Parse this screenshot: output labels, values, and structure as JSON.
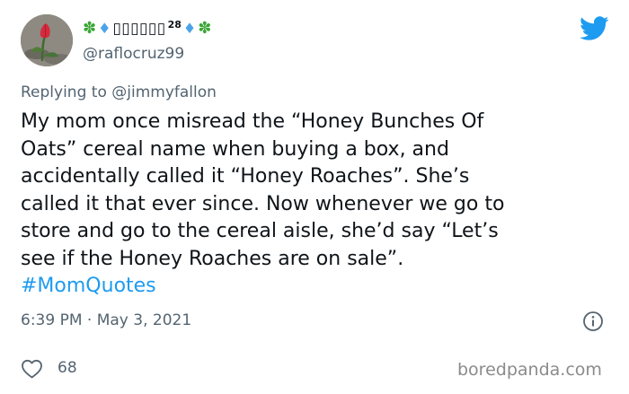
{
  "author": {
    "display_name_text": "▯▯▯▯▯▯",
    "display_name_superscript": "28",
    "decoration_left": "✽",
    "decoration_diamond": "♦",
    "decoration_right": "✽",
    "handle": "@raflocruz99",
    "avatar_icon": "tulip-avatar"
  },
  "platform_icon": "twitter-bird-icon",
  "reply": {
    "prefix": "Replying to ",
    "mention": "@jimmyfallon"
  },
  "tweet": {
    "lines": [
      "My mom once misread the “Honey Bunches Of",
      "Oats” cereal name when buying a box, and",
      "accidentally called it “Honey Roaches”. She’s",
      "called it that ever since. Now whenever we go to",
      "store and go to the cereal aisle, she’d say “Let’s",
      "see if the Honey Roaches are on sale”."
    ],
    "hashtag": "#MomQuotes"
  },
  "timestamp": "6:39 PM · May 3, 2021",
  "likes": "68",
  "watermark": "boredpanda.com",
  "colors": {
    "link_blue": "#1d9bf0",
    "muted_gray": "#536471",
    "text": "#0f1419",
    "clover_green": "#3aa635",
    "diamond_blue": "#4da3e8"
  }
}
